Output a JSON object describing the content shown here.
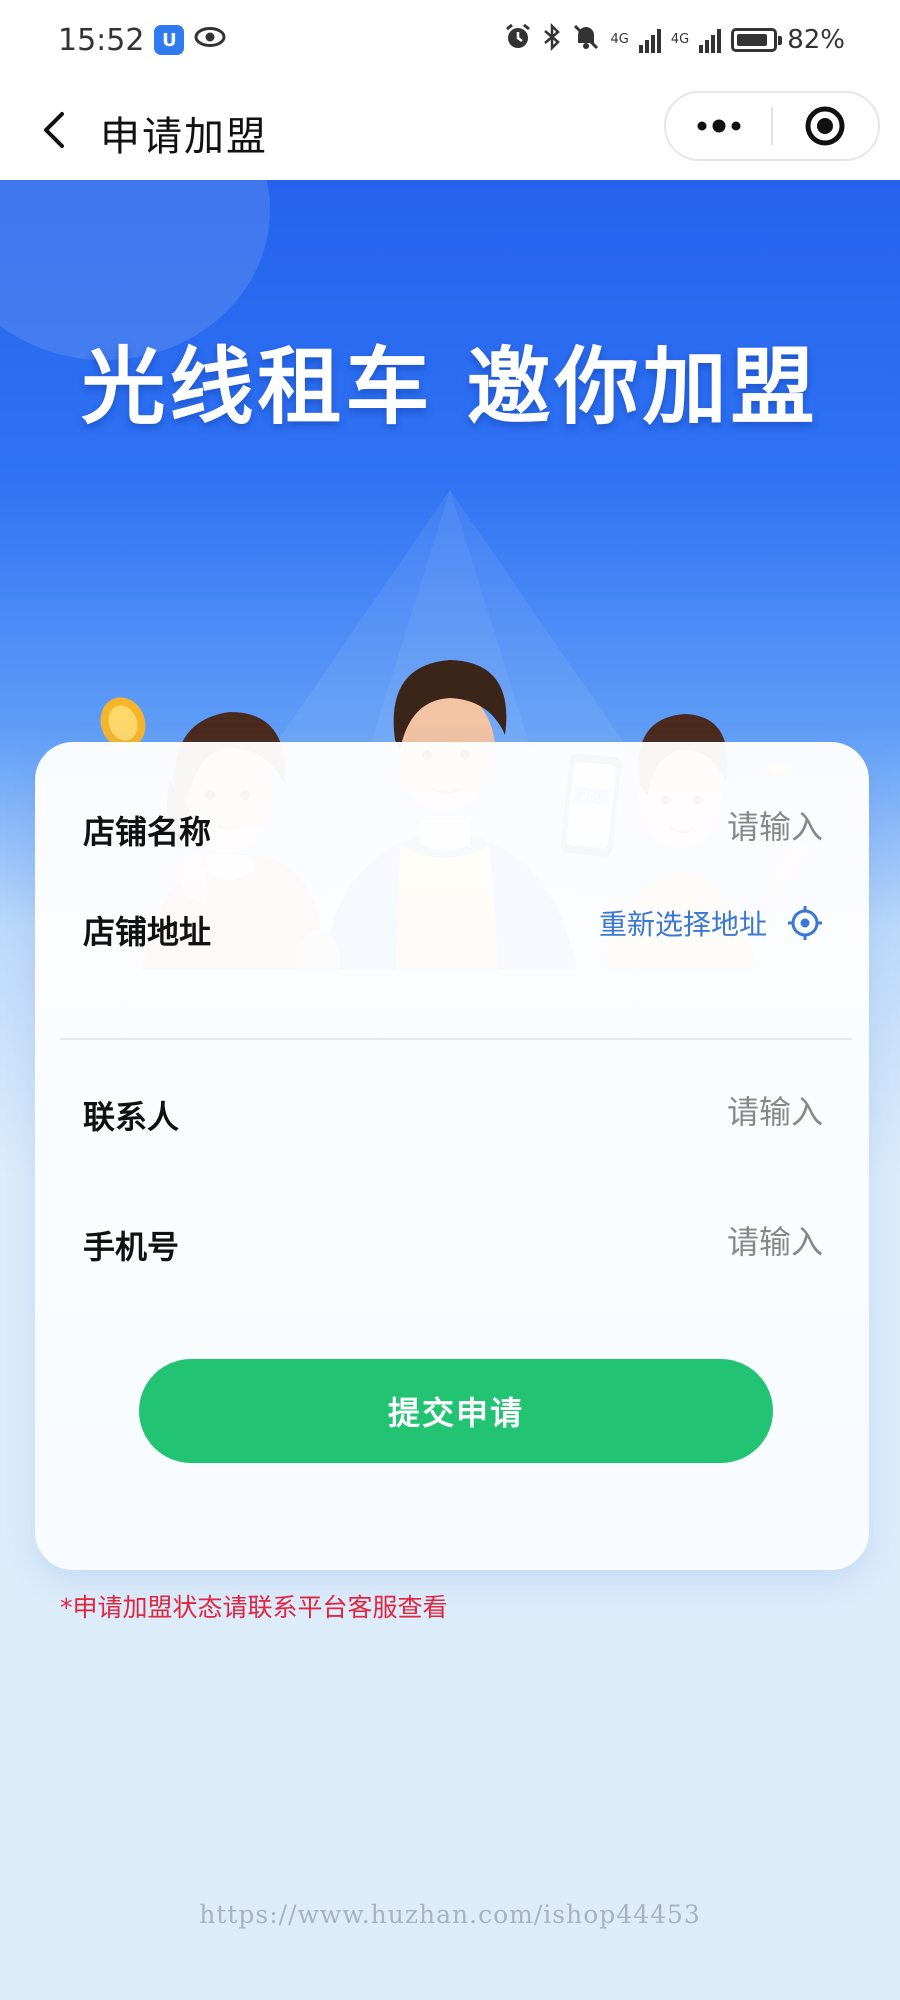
{
  "status_bar": {
    "time": "15:52",
    "app_badge": "U",
    "network_1": "4G",
    "network_2": "4G",
    "battery_percent": "82%"
  },
  "nav": {
    "title": "申请加盟"
  },
  "hero": {
    "headline": "光线租车  邀你加盟",
    "phone_badge": "200"
  },
  "form": {
    "store_name": {
      "label": "店铺名称",
      "placeholder": "请输入"
    },
    "store_address": {
      "label": "店铺地址",
      "action": "重新选择地址"
    },
    "contact": {
      "label": "联系人",
      "placeholder": "请输入"
    },
    "phone": {
      "label": "手机号",
      "placeholder": "请输入"
    },
    "submit_label": "提交申请"
  },
  "notice": "*申请加盟状态请联系平台客服查看",
  "watermark": "https://www.huzhan.com/ishop44453",
  "colors": {
    "brand_blue": "#2563ec",
    "submit_green": "#22c373",
    "link_blue": "#3a77d6",
    "notice_red": "#e0253e"
  }
}
